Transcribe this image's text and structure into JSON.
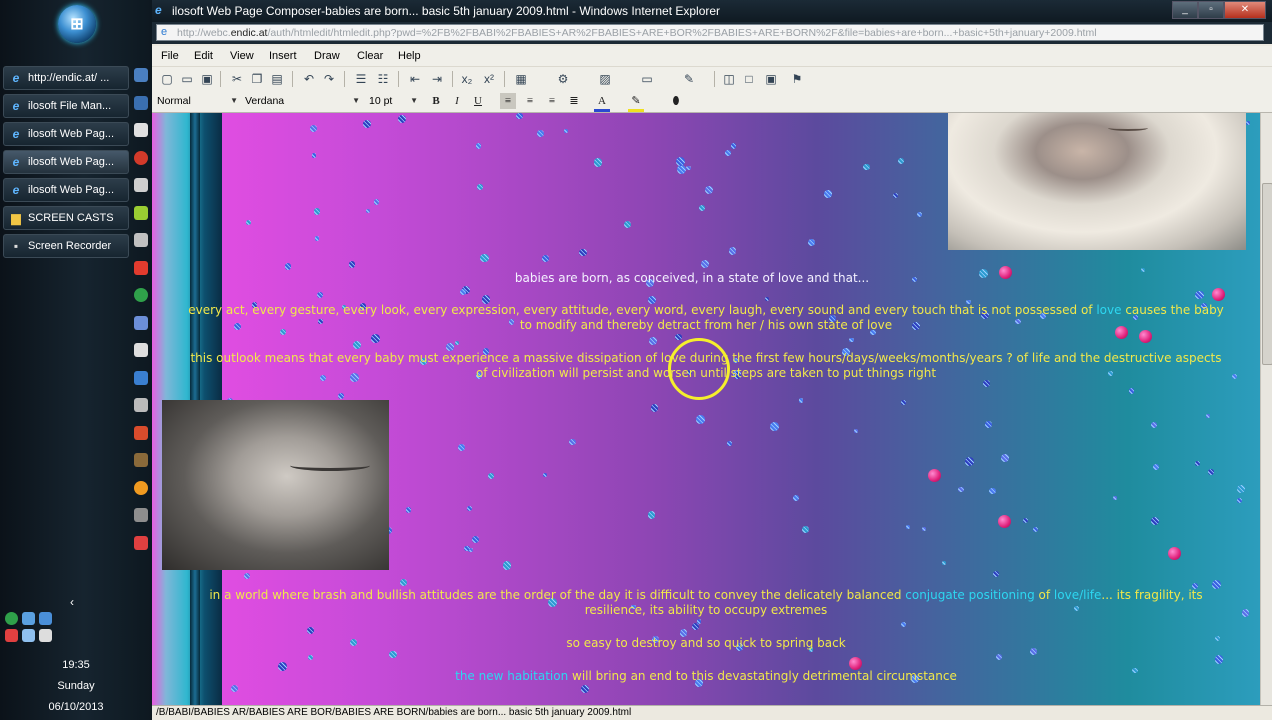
{
  "taskbar": {
    "start_label": "",
    "tasks": [
      {
        "label": "http://endic.at/ ...",
        "icon": "ie-icon"
      },
      {
        "label": "ilosoft File Man...",
        "icon": "ie-icon"
      },
      {
        "label": "ilosoft Web Pag...",
        "icon": "ie-icon"
      },
      {
        "label": "ilosoft Web Pag...",
        "icon": "ie-icon"
      },
      {
        "label": "ilosoft Web Pag...",
        "icon": "ie-icon"
      },
      {
        "label": "SCREEN CASTS",
        "icon": "folder-icon"
      },
      {
        "label": "Screen Recorder",
        "icon": "recorder-icon"
      }
    ],
    "clock": {
      "time": "19:35",
      "day": "Sunday",
      "date": "06/10/2013"
    }
  },
  "window": {
    "title": "ilosoft Web Page Composer-babies are born... basic 5th january 2009.html - Windows Internet Explorer",
    "address_prefix": "http://webc.",
    "address_domain": "endic.at",
    "address_rest": "/auth/htmledit/htmledit.php?pwd=%2FB%2FBABI%2FBABIES+AR%2FBABIES+ARE+BOR%2FBABIES+ARE+BORN%2F&file=babies+are+born...+basic+5th+january+2009.html",
    "menu": [
      "File",
      "Edit",
      "View",
      "Insert",
      "Draw",
      "Clear",
      "Help"
    ],
    "format": {
      "style": "Normal",
      "font": "Verdana",
      "size": "10 pt"
    },
    "status": "/B/BABI/BABIES AR/BABIES ARE BOR/BABIES ARE BORN/babies are born... basic 5th january 2009.html"
  },
  "content": {
    "line1": "babies are born, as conceived, in a state of love and that...",
    "p2_a": "every act, every gesture, every look, every expression, every attitude, every word, every laugh, every sound  and every touch that is not possessed of ",
    "p2_love": "love",
    "p2_b": " causes the baby",
    "p2_c": "to modify and thereby detract from her / his  own state of love",
    "p3_a": "this outlook means that every baby must experience a massive dissipation of love during the  first few hours/days/weeks/months/years ? of life and the destructive aspects",
    "p3_b": "of civilization will persist and worsen until steps are taken to put things right",
    "p4_a": "in a world where brash and bullish attitudes are the order of the day it is difficult to convey the delicately balanced ",
    "p4_cp": "conjugate positioning",
    "p4_of": " of ",
    "p4_ll": "love/life",
    "p4_b": "... its fragility, its",
    "p4_c": "resilience, its ability to occupy extremes",
    "p5": "so easy to destroy and so quick to spring back",
    "p6_nh": "the new habitation",
    "p6_rest": " will bring an end to this devastatingly detrimental circumstance"
  },
  "colors": {
    "text_white": "#f4f2ff",
    "text_yellow": "#f1e84a",
    "text_cyan": "#2dd7f1"
  }
}
